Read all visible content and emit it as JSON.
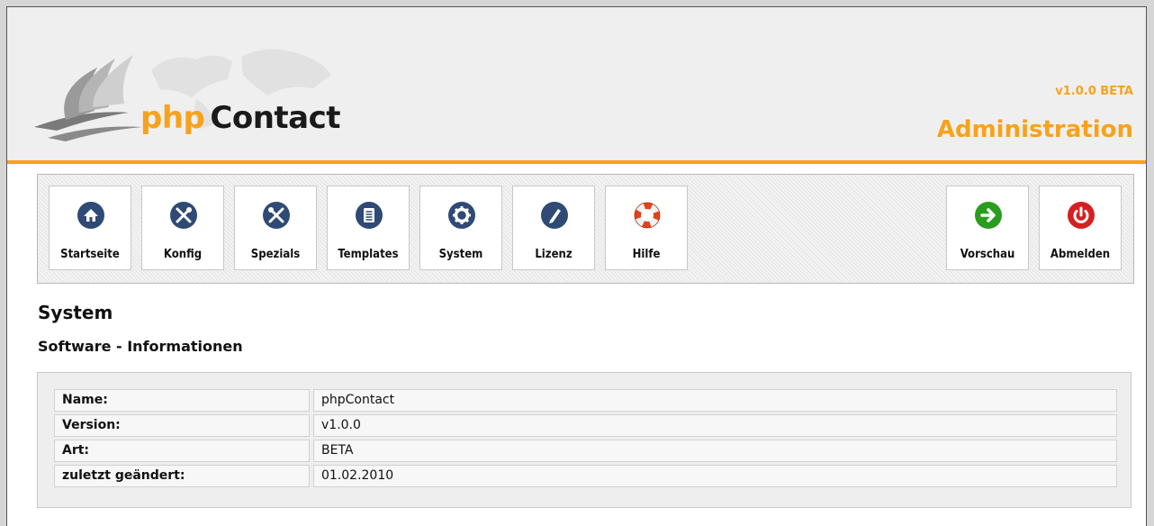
{
  "header": {
    "logo_php": "php",
    "logo_contact": "Contact",
    "version": "v1.0.0 BETA",
    "title": "Administration",
    "accent_color": "#f7a21c"
  },
  "toolbar": {
    "items": [
      {
        "label": "Startseite",
        "icon": "home-icon"
      },
      {
        "label": "Konfig",
        "icon": "tools-icon"
      },
      {
        "label": "Spezials",
        "icon": "tools-icon"
      },
      {
        "label": "Templates",
        "icon": "document-icon"
      },
      {
        "label": "System",
        "icon": "gear-icon"
      },
      {
        "label": "Lizenz",
        "icon": "pen-icon"
      },
      {
        "label": "Hilfe",
        "icon": "lifebuoy-icon"
      }
    ],
    "right_items": [
      {
        "label": "Vorschau",
        "icon": "arrow-right-icon",
        "color": "#2a9d1e"
      },
      {
        "label": "Abmelden",
        "icon": "power-icon",
        "color": "#d42020"
      }
    ]
  },
  "page": {
    "title": "System",
    "section_title": "Software - Informationen"
  },
  "info": {
    "rows": [
      {
        "key": "Name:",
        "value": "phpContact"
      },
      {
        "key": "Version:",
        "value": "v1.0.0"
      },
      {
        "key": "Art:",
        "value": "BETA"
      },
      {
        "key": "zuletzt geändert:",
        "value": "01.02.2010"
      }
    ]
  }
}
